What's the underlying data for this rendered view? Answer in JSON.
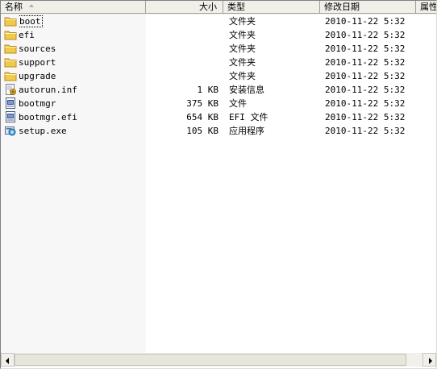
{
  "columns": {
    "name": "名称",
    "size": "大小",
    "type": "类型",
    "modified": "修改日期",
    "attributes": "属性"
  },
  "files": [
    {
      "name": "boot",
      "size": "",
      "type": "文件夹",
      "modified": "2010-11-22 5:32",
      "icon": "folder-icon"
    },
    {
      "name": "efi",
      "size": "",
      "type": "文件夹",
      "modified": "2010-11-22 5:32",
      "icon": "folder-icon"
    },
    {
      "name": "sources",
      "size": "",
      "type": "文件夹",
      "modified": "2010-11-22 5:32",
      "icon": "folder-icon"
    },
    {
      "name": "support",
      "size": "",
      "type": "文件夹",
      "modified": "2010-11-22 5:32",
      "icon": "folder-icon"
    },
    {
      "name": "upgrade",
      "size": "",
      "type": "文件夹",
      "modified": "2010-11-22 5:32",
      "icon": "folder-icon"
    },
    {
      "name": "autorun.inf",
      "size": "1 KB",
      "type": "安装信息",
      "modified": "2010-11-22 5:32",
      "icon": "setup-info-icon"
    },
    {
      "name": "bootmgr",
      "size": "375 KB",
      "type": "文件",
      "modified": "2010-11-22 5:32",
      "icon": "system-file-icon"
    },
    {
      "name": "bootmgr.efi",
      "size": "654 KB",
      "type": "EFI 文件",
      "modified": "2010-11-22 5:32",
      "icon": "system-file-icon"
    },
    {
      "name": "setup.exe",
      "size": "105 KB",
      "type": "应用程序",
      "modified": "2010-11-22 5:32",
      "icon": "setup-exe-icon"
    }
  ],
  "colors": {
    "folder": "#f2c94c",
    "header_bg": "#f0efe8",
    "sorted_column_bg": "#f7f7f7"
  }
}
